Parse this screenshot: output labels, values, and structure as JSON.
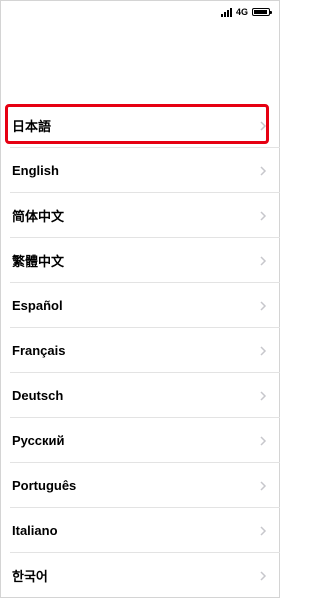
{
  "status_bar": {
    "network": "4G",
    "icons": [
      "signal-icon",
      "battery-icon"
    ]
  },
  "languages": [
    {
      "label": "日本語",
      "selected": true
    },
    {
      "label": "English"
    },
    {
      "label": "简体中文"
    },
    {
      "label": "繁體中文"
    },
    {
      "label": "Español"
    },
    {
      "label": "Français"
    },
    {
      "label": "Deutsch"
    },
    {
      "label": "Русский"
    },
    {
      "label": "Português"
    },
    {
      "label": "Italiano"
    },
    {
      "label": "한국어"
    }
  ],
  "colors": {
    "highlight": "#e60012",
    "chevron": "#c7c7cc",
    "divider": "#e3e3e3"
  }
}
